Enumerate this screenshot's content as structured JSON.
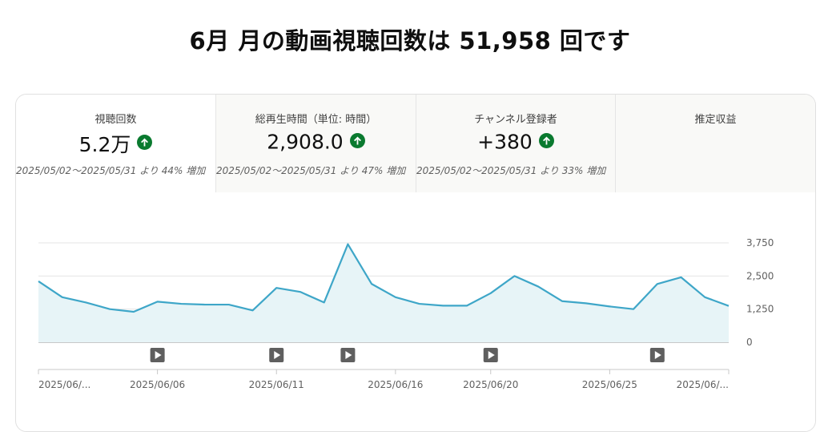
{
  "page": {
    "title": "6月 月の動画視聴回数は 51,958 回です"
  },
  "tabs": [
    {
      "label": "視聴回数",
      "value": "5.2万",
      "trend_icon": "arrow-up-circle-icon",
      "compare": "2025/05/02〜2025/05/31 より 44% 増加",
      "active": true
    },
    {
      "label": "総再生時間（単位: 時間）",
      "value": "2,908.0",
      "trend_icon": "arrow-up-circle-icon",
      "compare": "2025/05/02〜2025/05/31 より 47% 増加",
      "active": false
    },
    {
      "label": "チャンネル登録者",
      "value": "+380",
      "trend_icon": "arrow-up-circle-icon",
      "compare": "2025/05/02〜2025/05/31 より 33% 増加",
      "active": false
    },
    {
      "label": "推定収益",
      "value": "",
      "trend_icon": "",
      "compare": "",
      "active": false
    }
  ],
  "colors": {
    "accent_line": "#3ea6c8",
    "area_fill": "#e7f4f7",
    "trend_up": "#0a7a2f",
    "marker_bg": "#5f5f5f"
  },
  "chart_data": {
    "type": "area",
    "x": [
      "2025/06/01",
      "2025/06/02",
      "2025/06/03",
      "2025/06/04",
      "2025/06/05",
      "2025/06/06",
      "2025/06/07",
      "2025/06/08",
      "2025/06/09",
      "2025/06/10",
      "2025/06/11",
      "2025/06/12",
      "2025/06/13",
      "2025/06/14",
      "2025/06/15",
      "2025/06/16",
      "2025/06/17",
      "2025/06/18",
      "2025/06/19",
      "2025/06/20",
      "2025/06/21",
      "2025/06/22",
      "2025/06/23",
      "2025/06/24",
      "2025/06/25",
      "2025/06/26",
      "2025/06/27",
      "2025/06/28",
      "2025/06/29",
      "2025/06/30"
    ],
    "series": [
      {
        "values": [
          2300,
          1700,
          1500,
          1250,
          1150,
          1530,
          1450,
          1420,
          1420,
          1200,
          2050,
          1900,
          1500,
          3700,
          2200,
          1700,
          1450,
          1380,
          1380,
          1850,
          2500,
          2100,
          1550,
          1470,
          1350,
          1250,
          2200,
          2450,
          1700,
          1370
        ]
      }
    ],
    "ylim": [
      0,
      3750
    ],
    "yticks": [
      "0",
      "1,250",
      "2,500",
      "3,750"
    ],
    "xtick_labels": [
      "2025/06/...",
      "2025/06/06",
      "2025/06/11",
      "2025/06/16",
      "2025/06/20",
      "2025/06/25",
      "2025/06/..."
    ],
    "xtick_dates": [
      "2025/06/01",
      "2025/06/06",
      "2025/06/11",
      "2025/06/16",
      "2025/06/20",
      "2025/06/25",
      "2025/06/30"
    ],
    "video_markers": [
      "2025/06/06",
      "2025/06/11",
      "2025/06/14",
      "2025/06/20",
      "2025/06/27"
    ],
    "grid": true
  }
}
